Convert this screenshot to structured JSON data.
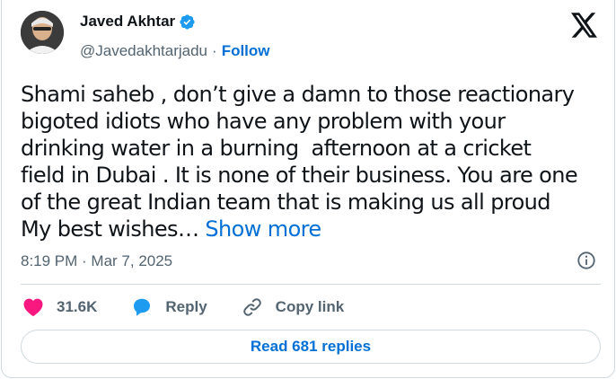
{
  "author": {
    "name": "Javed Akhtar",
    "handle": "@Javedakhtarjadu",
    "separator": "·",
    "follow_label": "Follow"
  },
  "tweet": {
    "text": "Shami saheb , don’t give a damn to those reactionary bigoted idiots who have any problem with your drinking water in a burning  afternoon at a cricket  field in Dubai . It is none of their business. You are one of the great Indian team that is making us all proud My best wishes… ",
    "show_more": "Show more",
    "timestamp": "8:19 PM · Mar 7, 2025"
  },
  "actions": {
    "likes": "31.6K",
    "reply_label": "Reply",
    "copy_label": "Copy link"
  },
  "read_replies_label": "Read 681 replies",
  "colors": {
    "accent": "#006fd6",
    "like": "#f91880",
    "verified": "#1d9bf0",
    "text": "#0f1419",
    "muted": "#536471",
    "border": "#cfd9de"
  },
  "icons": [
    "verified-badge-icon",
    "x-logo-icon",
    "info-icon",
    "heart-icon",
    "reply-bubble-icon",
    "link-icon"
  ]
}
